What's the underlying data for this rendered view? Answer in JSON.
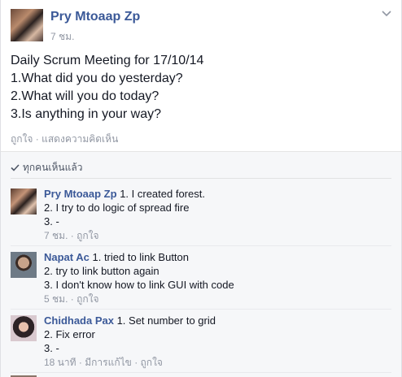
{
  "post": {
    "author": "Pry Mtoaap Zp",
    "time": "7 ชม.",
    "lines": [
      "Daily Scrum Meeting for 17/10/14",
      "1.What did you do yesterday?",
      "2.What will you do today?",
      "3.Is anything in your way?"
    ],
    "actions": {
      "like": "ถูกใจ",
      "separator": "·",
      "comment": "แสดงความคิดเห็น"
    }
  },
  "seen": {
    "label": "ทุกคนเห็นแล้ว"
  },
  "comments": [
    {
      "author": "Pry Mtoaap Zp",
      "line1": " 1. I created forest.",
      "line2": "2. I try to do logic of spread fire",
      "line3": "3. -",
      "time": "7 ชม.",
      "edited": "",
      "like": "ถูกใจ"
    },
    {
      "author": "Napat Ac",
      "line1": " 1. tried to link Button",
      "line2": "2. try to link button again",
      "line3": "3. I don't know how to link GUI with code",
      "time": "5 ชม.",
      "edited": "",
      "like": "ถูกใจ"
    },
    {
      "author": "Chidhada Pax",
      "line1": " 1. Set number to grid",
      "line2": "2. Fix error",
      "line3": "3. -",
      "time": "18 นาที",
      "edited": "มีการแก้ไข",
      "like": "ถูกใจ"
    }
  ],
  "colors": {
    "link": "#3b5998",
    "meta": "#9197a3",
    "text": "#141823",
    "comments_bg": "#f6f7f9"
  }
}
